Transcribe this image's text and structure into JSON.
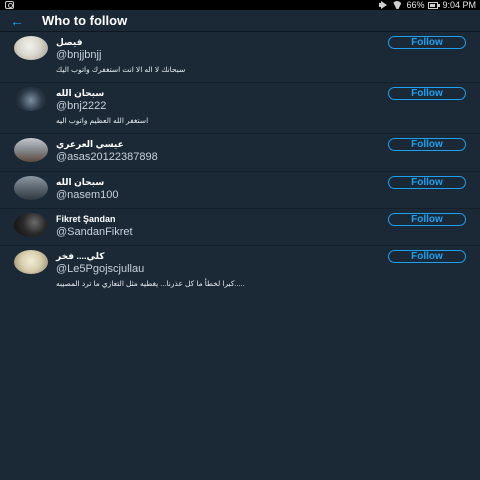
{
  "status_bar": {
    "battery": "66%",
    "time": "9:04 PM"
  },
  "header": {
    "back_icon": "back-arrow-icon",
    "title": "Who to follow"
  },
  "suggestions": [
    {
      "name": "فيصل",
      "handle": "@bnjjbnjj",
      "bio": "سبحانك لا اله الا انت استغفرك واتوب اليك",
      "follow_label": "Follow"
    },
    {
      "name": "سبحان الله",
      "handle": "@bnj2222",
      "bio": "استغفر الله العظيم واتوب اليه",
      "follow_label": "Follow"
    },
    {
      "name": "عيسي العرعري",
      "handle": "@asas20122387898",
      "bio": "",
      "follow_label": "Follow"
    },
    {
      "name": "سبحان الله",
      "handle": "@nasem100",
      "bio": "",
      "follow_label": "Follow"
    },
    {
      "name": "Fikret Şandan",
      "handle": "@SandanFikret",
      "bio": "",
      "follow_label": "Follow"
    },
    {
      "name": "كلي.... فخر",
      "handle": "@Le5Pgojscjullau",
      "bio": "كبرا لخطأ ما كل عذرنا... يغطيه مثل التعازي ما ترد المصيبه.....",
      "follow_label": "Follow"
    }
  ],
  "colors": {
    "background": "#1b2836",
    "accent": "#1da1f2"
  }
}
